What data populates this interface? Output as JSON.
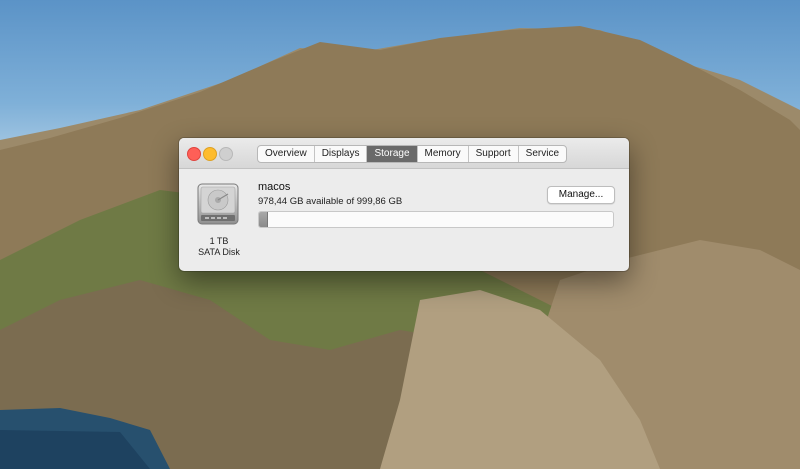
{
  "window": {
    "tabs": [
      {
        "label": "Overview",
        "active": false
      },
      {
        "label": "Displays",
        "active": false
      },
      {
        "label": "Storage",
        "active": true
      },
      {
        "label": "Memory",
        "active": false
      },
      {
        "label": "Support",
        "active": false
      },
      {
        "label": "Service",
        "active": false
      }
    ]
  },
  "storage": {
    "disk_icon": "hard-drive-icon",
    "disk_size": "1 TB",
    "disk_type": "SATA Disk",
    "volume_name": "macos",
    "availability": "978,44 GB available of 999,86 GB",
    "manage_label": "Manage...",
    "used_fraction": 0.0214
  },
  "colors": {
    "close": "#fe5f57",
    "minimize": "#febc2e",
    "zoom_disabled": "#cfcfcf",
    "active_tab": "#6a6a6a",
    "used_bar": "#8a8a8a"
  }
}
